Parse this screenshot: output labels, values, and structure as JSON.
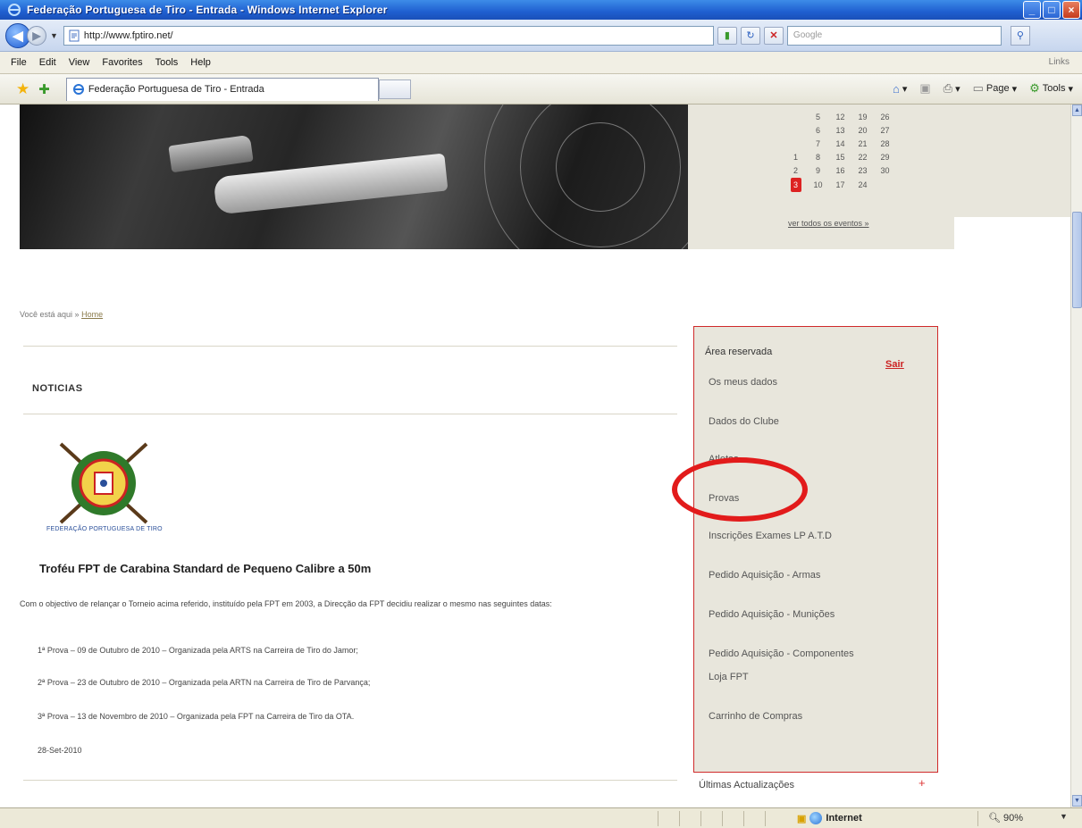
{
  "window": {
    "title": "Federação Portuguesa de Tiro - Entrada - Windows Internet Explorer",
    "controls": {
      "minimize": "_",
      "maximize": "□",
      "close": "×"
    }
  },
  "browser": {
    "url": "http://www.fptiro.net/",
    "search_placeholder": "Google",
    "menu": [
      "File",
      "Edit",
      "View",
      "Favorites",
      "Tools",
      "Help"
    ],
    "links_label": "Links",
    "tab_title": "Federação Portuguesa de Tiro - Entrada",
    "commands": {
      "page": "Page",
      "tools": "Tools"
    },
    "status": {
      "zone": "Internet",
      "zoom": "90%"
    }
  },
  "calendar": {
    "rows": [
      [
        "",
        "5",
        "12",
        "19",
        "26"
      ],
      [
        "",
        "6",
        "13",
        "20",
        "27"
      ],
      [
        "",
        "7",
        "14",
        "21",
        "28"
      ],
      [
        "1",
        "8",
        "15",
        "22",
        "29"
      ],
      [
        "2",
        "9",
        "16",
        "23",
        "30"
      ],
      [
        "3",
        "10",
        "17",
        "24",
        ""
      ]
    ],
    "today": "3",
    "link": "ver todos os eventos »"
  },
  "breadcrumb": {
    "prefix": "Você está aqui »",
    "link": "Home"
  },
  "news": {
    "heading": "NOTICIAS",
    "logo_caption": "FEDERAÇÃO PORTUGUESA DE TIRO",
    "title": "Troféu FPT de Carabina Standard de Pequeno Calibre a 50m",
    "body": "Com o objectivo de relançar o Torneio acima referido, instituído pela FPT em 2003, a Direcção da FPT decidiu realizar o mesmo nas seguintes datas:",
    "items": [
      "1ª Prova – 09 de Outubro de 2010 – Organizada pela ARTS na Carreira de Tiro do Jamor;",
      "2ª Prova – 23 de Outubro de 2010 – Organizada pela ARTN na Carreira de Tiro de Parvança;",
      "3ª Prova – 13 de Novembro de 2010 – Organizada pela FPT na Carreira de Tiro da OTA."
    ],
    "date": "28-Set-2010"
  },
  "reserved_area": {
    "title": "Área reservada",
    "logout": "Sair",
    "links": [
      "Os meus dados",
      "Dados do Clube",
      "Atletas",
      "Provas",
      "Inscrições Exames LP A.T.D",
      "Pedido Aquisição - Armas",
      "Pedido Aquisição - Munições",
      "Pedido Aquisição - Componentes",
      "Loja FPT",
      "Carrinho de Compras"
    ]
  },
  "last_updates": {
    "label": "Últimas Actualizações",
    "icon": "+"
  },
  "colors": {
    "accent_red": "#d02a2a",
    "panel_bg": "#e8e6dc",
    "highlight": "#e21b1b"
  }
}
